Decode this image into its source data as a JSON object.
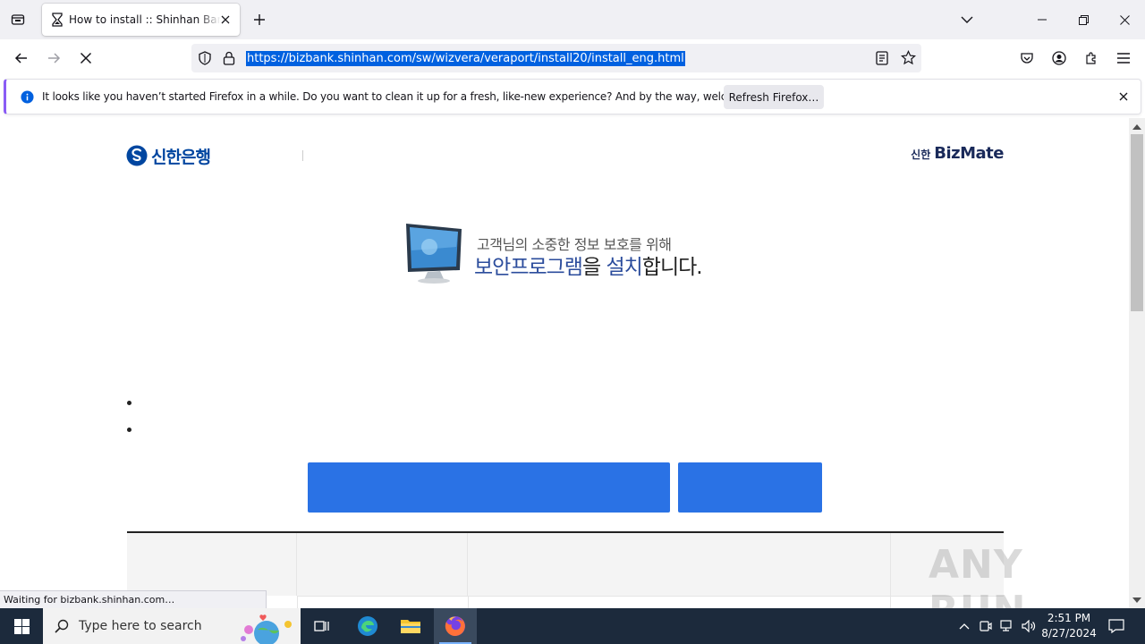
{
  "browser": {
    "tab": {
      "title": "How to install :: Shinhan Bank internet banking"
    },
    "url": "https://bizbank.shinhan.com/sw/wizvera/veraport/install20/install_eng.html",
    "notification": {
      "message": "It looks like you haven’t started Firefox in a while. Do you want to clean it up for a fresh, like-new experience? And by the way, welcome back!",
      "button": "Refresh Firefox…"
    },
    "status": "Waiting for bizbank.shinhan.com…"
  },
  "page": {
    "logo_left": "신한은행",
    "logo_right_small": "신한",
    "logo_right_big": "BizMate",
    "hero_line1": "고객님의 소중한 정보 보호를 위해",
    "hero_line2_blue": "보안프로그램",
    "hero_line2_part": "을 ",
    "hero_line2_blue2": "설치",
    "hero_line2_rest": "합니다."
  },
  "taskbar": {
    "search_placeholder": "Type here to search",
    "time": "2:51 PM",
    "date": "8/27/2024"
  },
  "watermark": "ANY RUN",
  "colors": {
    "accent_button": "#2a72e5",
    "url_highlight": "#0061e0",
    "taskbar": "#1c2a3c"
  }
}
